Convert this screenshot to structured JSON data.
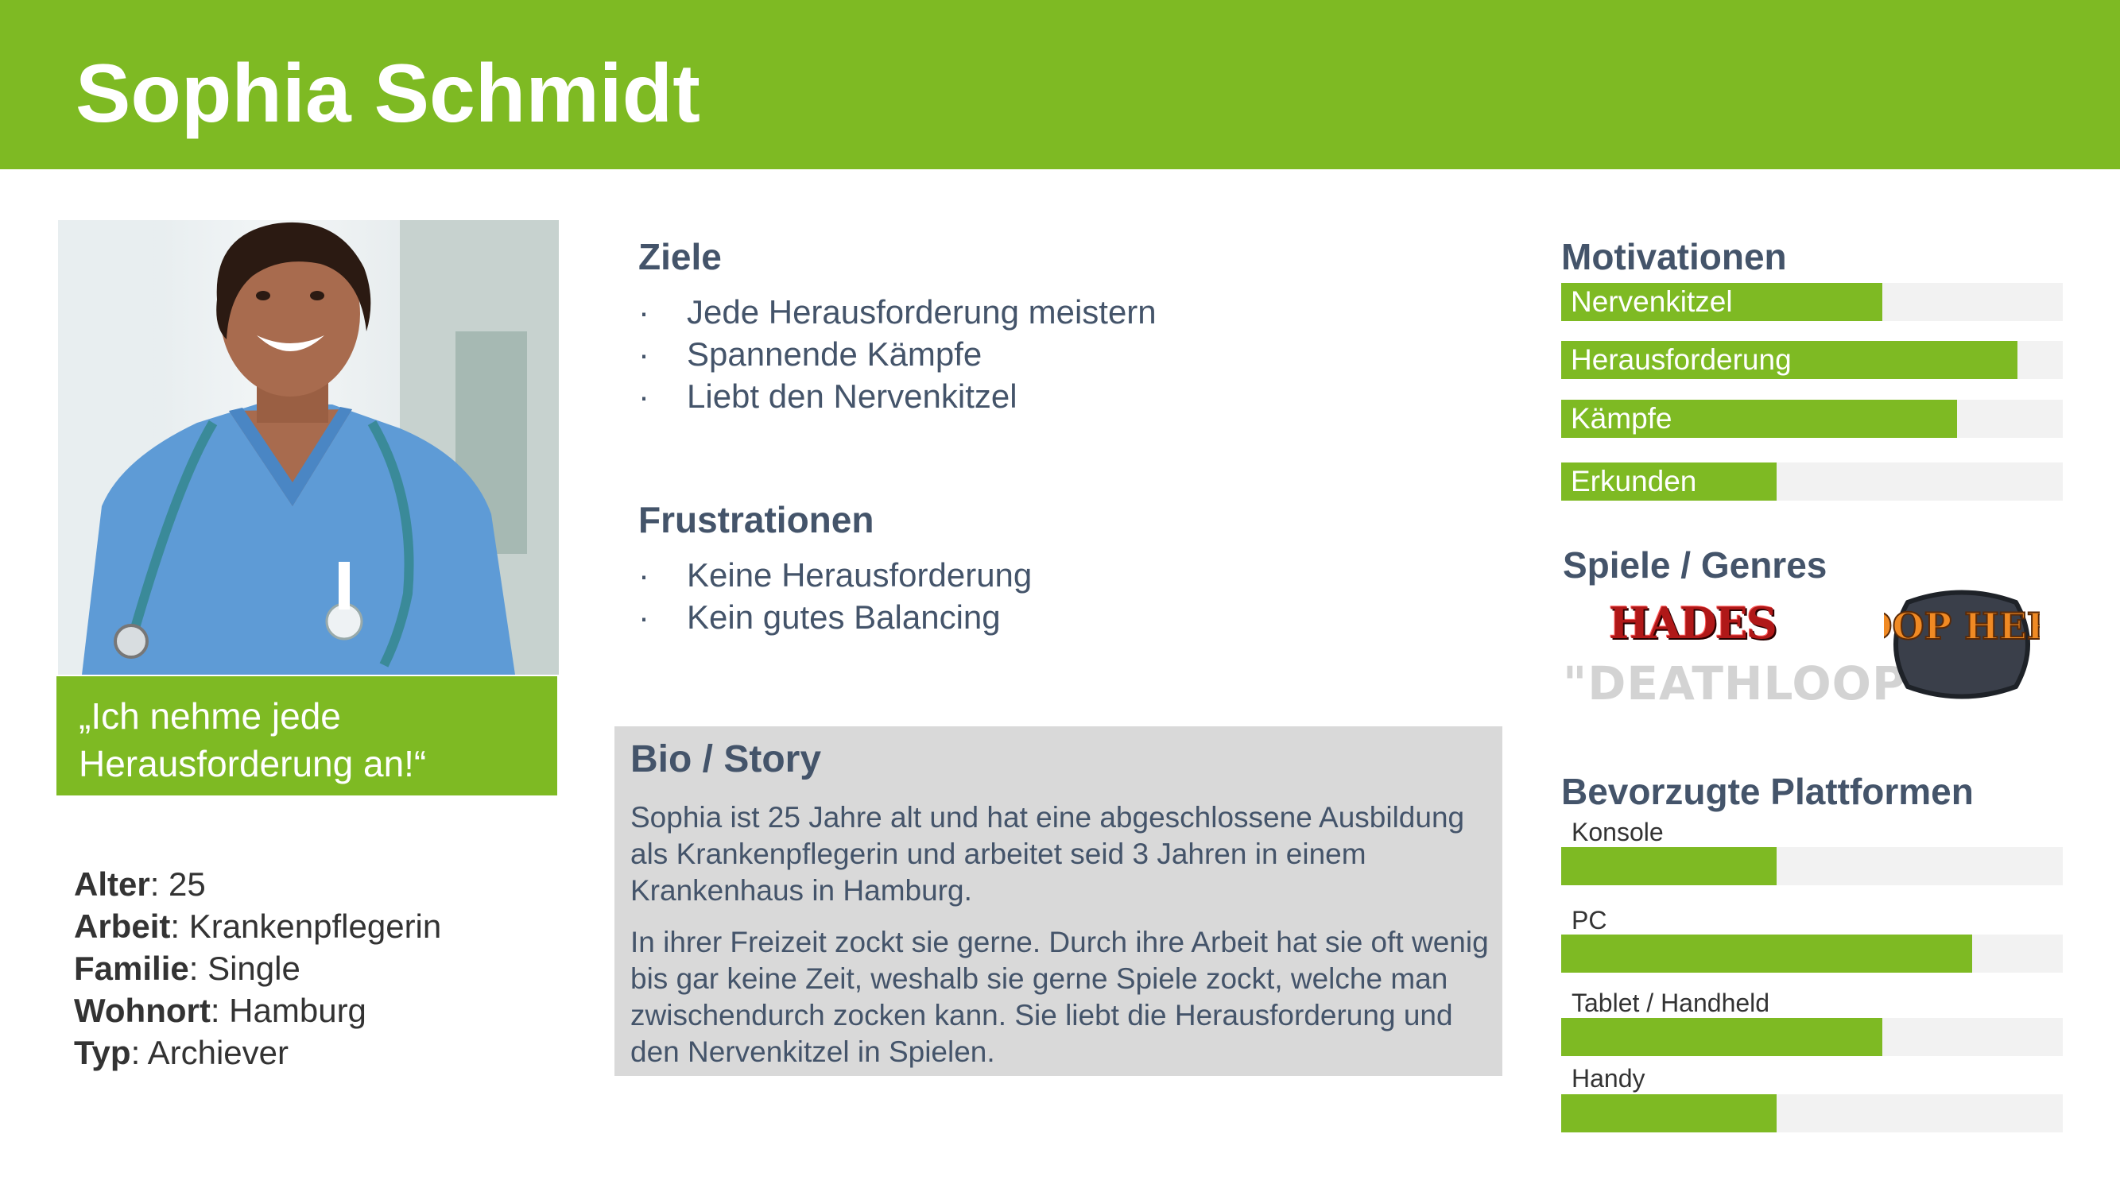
{
  "header": {
    "name": "Sophia Schmidt"
  },
  "profile": {
    "quote": "„Ich nehme jede Herausforderung an!“",
    "facts": [
      {
        "label": "Alter",
        "value": ": 25"
      },
      {
        "label": "Arbeit",
        "value": ": Krankenpflegerin"
      },
      {
        "label": "Familie",
        "value": ": Single"
      },
      {
        "label": "Wohnort",
        "value": ": Hamburg"
      },
      {
        "label": "Typ",
        "value": ": Archiever"
      }
    ]
  },
  "goals": {
    "title": "Ziele",
    "items": [
      "Jede Herausforderung meistern",
      "Spannende Kämpfe",
      "Liebt den Nervenkitzel"
    ]
  },
  "frustrations": {
    "title": "Frustrationen",
    "items": [
      "Keine Herausforderung",
      "Kein gutes Balancing"
    ]
  },
  "bio": {
    "title": "Bio / Story",
    "paragraphs": [
      "Sophia ist 25 Jahre alt und hat eine abgeschlossene Ausbildung als Krankenpflegerin und arbeitet seid 3 Jahren in einem Krankenhaus in Hamburg.",
      "In ihrer Freizeit zockt sie gerne. Durch ihre Arbeit hat sie oft wenig bis gar keine Zeit, weshalb sie gerne Spiele zockt, welche man zwischendurch zocken kann. Sie liebt die Herausforderung und den Nervenkitzel in Spielen."
    ]
  },
  "motivations": {
    "title": "Motivationen",
    "items": [
      {
        "label": "Nervenkitzel",
        "level": 0.64
      },
      {
        "label": "Herausforderung",
        "level": 0.91
      },
      {
        "label": "Kämpfe",
        "level": 0.79
      },
      {
        "label": "Erkunden",
        "level": 0.43
      }
    ]
  },
  "games": {
    "title": "Spiele / Genres",
    "logos": [
      "HADES",
      "\"DEATHLOOP\"",
      "LOOP HERO"
    ]
  },
  "platforms": {
    "title": "Bevorzugte Plattformen",
    "items": [
      {
        "label": "Konsole",
        "level": 0.43
      },
      {
        "label": "PC",
        "level": 0.82
      },
      {
        "label": "Tablet / Handheld",
        "level": 0.64
      },
      {
        "label": "Handy",
        "level": 0.43
      }
    ]
  },
  "colors": {
    "accent": "#7eba23",
    "text": "#44546a",
    "track": "#f2f2f2",
    "bio_bg": "#d9d9d9"
  }
}
